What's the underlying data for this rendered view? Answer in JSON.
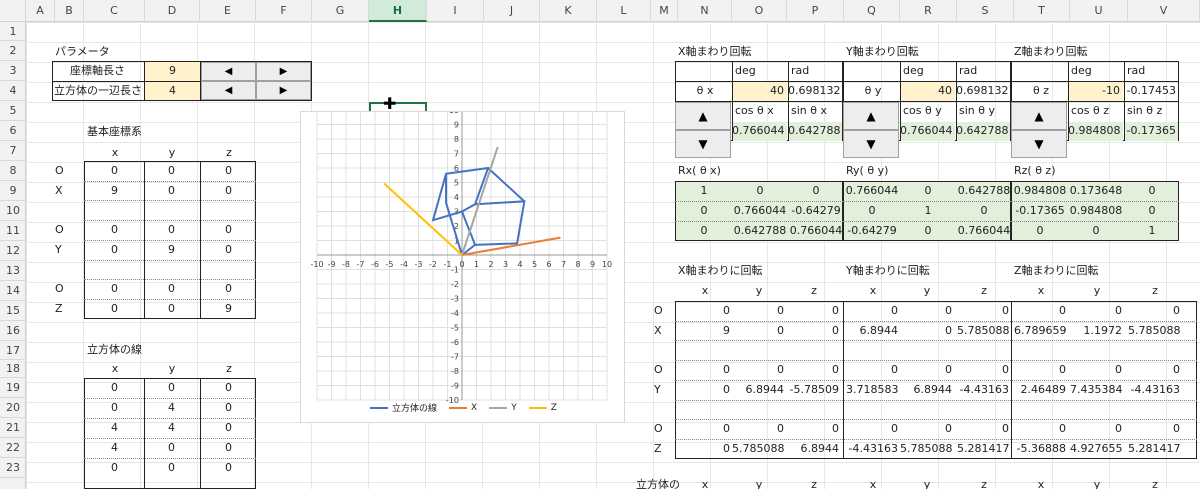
{
  "columns": [
    "A",
    "B",
    "C",
    "D",
    "E",
    "F",
    "G",
    "H",
    "I",
    "J",
    "K",
    "L",
    "M",
    "N",
    "O",
    "P",
    "Q",
    "R",
    "S",
    "T",
    "U",
    "V"
  ],
  "rows": [
    "1",
    "2",
    "3",
    "4",
    "5",
    "6",
    "7",
    "8",
    "9",
    "10",
    "11",
    "12",
    "13",
    "14",
    "15",
    "16",
    "17",
    "18",
    "19",
    "20",
    "21",
    "22",
    "23"
  ],
  "selected_column": "H",
  "params": {
    "title": "パラメータ",
    "axis_label": "座標軸長さ",
    "axis_value": "9",
    "cube_label": "立方体の一辺長さ",
    "cube_value": "4",
    "left_arrow": "◀",
    "right_arrow": "▶"
  },
  "base": {
    "title": "基本座標系",
    "headers": [
      "x",
      "y",
      "z"
    ],
    "rows": [
      {
        "label": "O",
        "v": [
          "0",
          "0",
          "0"
        ]
      },
      {
        "label": "X",
        "v": [
          "9",
          "0",
          "0"
        ]
      },
      {
        "label": "",
        "v": [
          "",
          "",
          ""
        ]
      },
      {
        "label": "O",
        "v": [
          "0",
          "0",
          "0"
        ]
      },
      {
        "label": "Y",
        "v": [
          "0",
          "9",
          "0"
        ]
      },
      {
        "label": "",
        "v": [
          "",
          "",
          ""
        ]
      },
      {
        "label": "O",
        "v": [
          "0",
          "0",
          "0"
        ]
      },
      {
        "label": "Z",
        "v": [
          "0",
          "0",
          "9"
        ]
      }
    ]
  },
  "cube": {
    "title": "立方体の線",
    "headers": [
      "x",
      "y",
      "z"
    ],
    "rows": [
      [
        "0",
        "0",
        "0"
      ],
      [
        "0",
        "4",
        "0"
      ],
      [
        "4",
        "4",
        "0"
      ],
      [
        "4",
        "0",
        "0"
      ],
      [
        "0",
        "0",
        "0"
      ]
    ]
  },
  "rot": {
    "x": {
      "title": "X軸まわり回転",
      "deg_label": "deg",
      "rad_label": "rad",
      "theta": "θ x",
      "deg": "40",
      "rad": "0.698132",
      "cos_label": "cos θ x",
      "sin_label": "sin θ x",
      "cos": "0.766044",
      "sin": "0.642788"
    },
    "y": {
      "title": "Y軸まわり回転",
      "deg_label": "deg",
      "rad_label": "rad",
      "theta": "θ y",
      "deg": "40",
      "rad": "0.698132",
      "cos_label": "cos θ y",
      "sin_label": "sin θ y",
      "cos": "0.766044",
      "sin": "0.642788"
    },
    "z": {
      "title": "Z軸まわり回転",
      "deg_label": "deg",
      "rad_label": "rad",
      "theta": "θ z",
      "deg": "-10",
      "rad": "-0.17453",
      "cos_label": "cos θ z",
      "sin_label": "sin θ z",
      "cos": "0.984808",
      "sin": "-0.17365"
    },
    "up": "▲",
    "down": "▼"
  },
  "matrices": {
    "x": {
      "title": "Rx( θ x)",
      "m": [
        [
          "1",
          "0",
          "0"
        ],
        [
          "0",
          "0.766044",
          "-0.64279"
        ],
        [
          "0",
          "0.642788",
          "0.766044"
        ]
      ]
    },
    "y": {
      "title": "Ry( θ y)",
      "m": [
        [
          "0.766044",
          "0",
          "0.642788"
        ],
        [
          "0",
          "1",
          "0"
        ],
        [
          "-0.64279",
          "0",
          "0.766044"
        ]
      ]
    },
    "z": {
      "title": "Rz( θ z)",
      "m": [
        [
          "0.984808",
          "0.173648",
          "0"
        ],
        [
          "-0.17365",
          "0.984808",
          "0"
        ],
        [
          "0",
          "0",
          "1"
        ]
      ]
    }
  },
  "results": {
    "titles": [
      "X軸まわりに回転",
      "Y軸まわりに回転",
      "Z軸まわりに回転"
    ],
    "headers": [
      "x",
      "y",
      "z",
      "x",
      "y",
      "z",
      "x",
      "y",
      "z"
    ],
    "labels": [
      "O",
      "X",
      "",
      "O",
      "Y",
      "",
      "O",
      "Z"
    ],
    "rows": [
      [
        "0",
        "0",
        "0",
        "0",
        "0",
        "0",
        "0",
        "0",
        "0"
      ],
      [
        "9",
        "0",
        "0",
        "6.8944",
        "0",
        "5.785088",
        "6.789659",
        "1.1972",
        "5.785088"
      ],
      [
        "",
        "",
        "",
        "",
        "",
        "",
        "",
        "",
        ""
      ],
      [
        "0",
        "0",
        "0",
        "0",
        "0",
        "0",
        "0",
        "0",
        "0"
      ],
      [
        "0",
        "6.8944",
        "-5.78509",
        "3.718583",
        "6.8944",
        "-4.43163",
        "2.46489",
        "7.435384",
        "-4.43163"
      ],
      [
        "",
        "",
        "",
        "",
        "",
        "",
        "",
        "",
        ""
      ],
      [
        "0",
        "0",
        "0",
        "0",
        "0",
        "0",
        "0",
        "0",
        "0"
      ],
      [
        "0",
        "5.785088",
        "6.8944",
        "-4.43163",
        "5.785088",
        "5.281417",
        "-5.36888",
        "4.927655",
        "5.281417"
      ]
    ],
    "bottom_label": "立方体の",
    "bottom_headers": [
      "x",
      "y",
      "z",
      "x",
      "y",
      "z",
      "x",
      "y",
      "z"
    ]
  },
  "chart_data": {
    "type": "scatter",
    "title": "",
    "xlim": [
      -10,
      10
    ],
    "ylim": [
      -10,
      10
    ],
    "ticks": [
      "-10",
      "-9",
      "-8",
      "-7",
      "-6",
      "-5",
      "-4",
      "-3",
      "-2",
      "-1",
      "0",
      "1",
      "2",
      "3",
      "4",
      "5",
      "6",
      "7",
      "8",
      "9",
      "10"
    ],
    "grid": true,
    "legend_position": "bottom",
    "series": [
      {
        "name": "立方体の線",
        "color": "#4472c4",
        "points": [
          [
            0,
            0
          ],
          [
            -1.1,
            3.6
          ],
          [
            -1.1,
            5.6
          ],
          [
            1.8,
            6.0
          ],
          [
            4.3,
            3.7
          ],
          [
            3.8,
            0.8
          ],
          [
            0.9,
            0.7
          ],
          [
            0,
            3.0
          ],
          [
            -2.0,
            2.4
          ],
          [
            -1.1,
            5.6
          ],
          [
            1.8,
            6.0
          ],
          [
            0.9,
            3.5
          ],
          [
            0,
            3.0
          ],
          [
            0.9,
            3.5
          ],
          [
            4.3,
            3.7
          ],
          [
            3.8,
            0.8
          ],
          [
            0.9,
            0.7
          ],
          [
            0,
            0
          ]
        ]
      },
      {
        "name": "X",
        "color": "#ed7d31",
        "points": [
          [
            0,
            0
          ],
          [
            6.79,
            1.2
          ]
        ]
      },
      {
        "name": "Y",
        "color": "#a5a5a5",
        "points": [
          [
            0,
            0
          ],
          [
            2.46,
            7.44
          ]
        ]
      },
      {
        "name": "Z",
        "color": "#ffc000",
        "points": [
          [
            0,
            0
          ],
          [
            -5.37,
            4.93
          ]
        ]
      }
    ]
  }
}
